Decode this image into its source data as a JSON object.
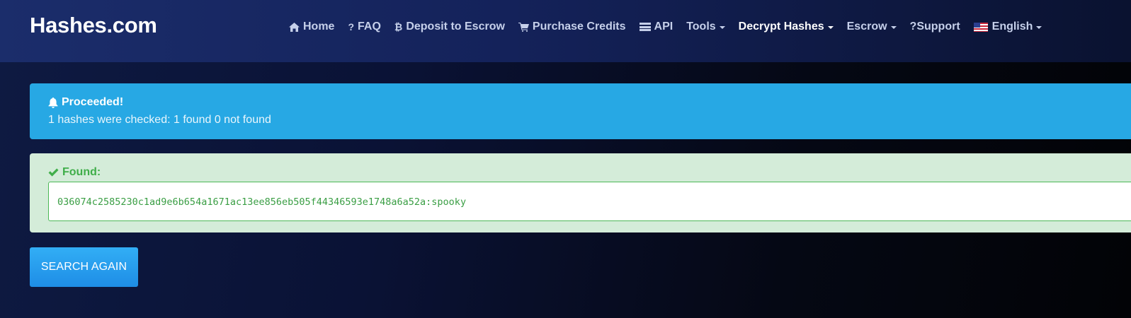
{
  "brand": {
    "name": "Hashes.com"
  },
  "nav": {
    "items": [
      {
        "icon": "home-icon",
        "label": "Home"
      },
      {
        "icon": "question-icon",
        "label": "FAQ"
      },
      {
        "icon": "bitcoin-icon",
        "label": "Deposit to Escrow"
      },
      {
        "icon": "cart-icon",
        "label": "Purchase Credits"
      },
      {
        "icon": "server-icon",
        "label": "API"
      },
      {
        "label": "Tools",
        "dropdown": true
      },
      {
        "label": "Decrypt Hashes",
        "dropdown": true,
        "active": true
      },
      {
        "label": "Escrow",
        "dropdown": true
      },
      {
        "label": "?Support"
      },
      {
        "icon": "us-flag-icon",
        "label": "English",
        "dropdown": true
      }
    ]
  },
  "info_alert": {
    "title": "Proceeded!",
    "message": "1 hashes were checked: 1 found 0 not found",
    "color": "#27a8e4"
  },
  "found_alert": {
    "title": "Found:",
    "result": "036074c2585230c1ad9e6b654a1671ac13ee856eb505f44346593e1748a6a52a:spooky",
    "color": "#3fae49"
  },
  "actions": {
    "search_again_label": "Search again"
  }
}
